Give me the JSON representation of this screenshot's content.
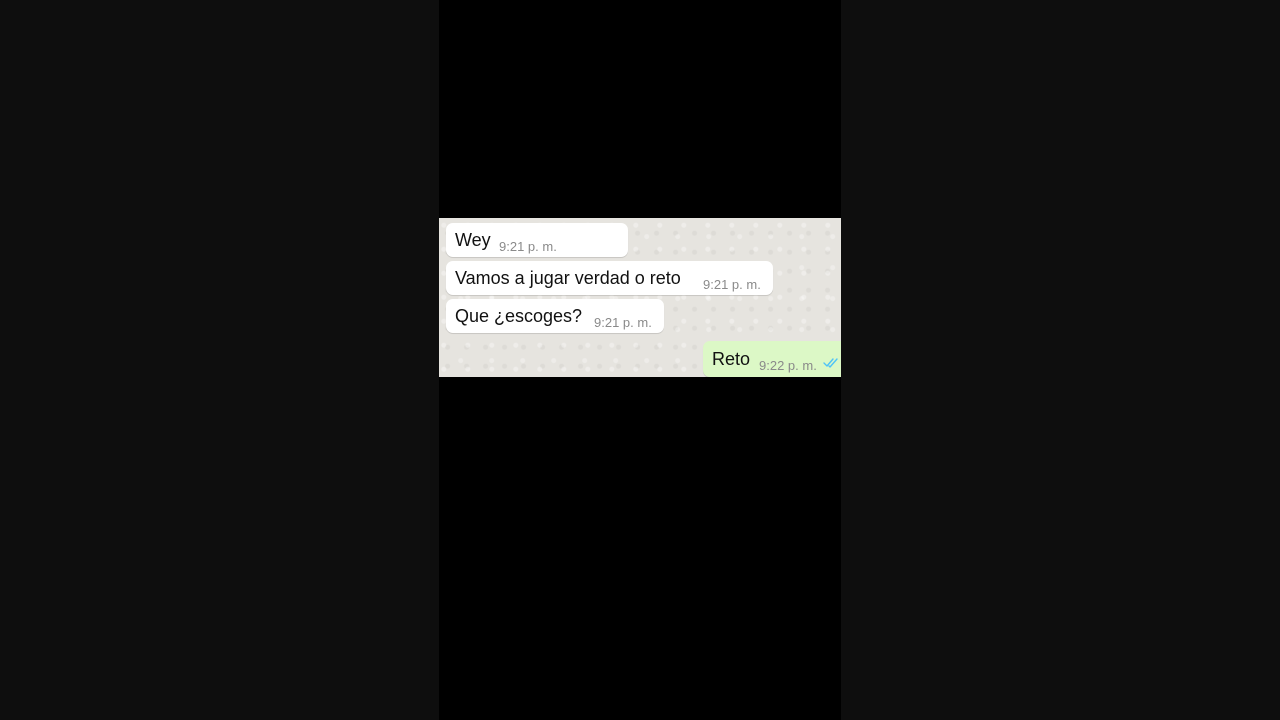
{
  "messages": [
    {
      "direction": "incoming",
      "text": "Wey",
      "time": "9:21 p. m."
    },
    {
      "direction": "incoming",
      "text": "Vamos a jugar verdad o reto",
      "time": "9:21 p. m."
    },
    {
      "direction": "incoming",
      "text": "Que ¿escoges?",
      "time": "9:21 p. m."
    },
    {
      "direction": "outgoing",
      "text": "Reto",
      "time": "9:22 p. m.",
      "status_icon": "double-check-read-icon"
    }
  ],
  "colors": {
    "page_background": "#0e0e0e",
    "phone_background": "#000000",
    "chat_wallpaper": "#e6e4df",
    "incoming_bubble": "#ffffff",
    "outgoing_bubble": "#dcf8c6",
    "read_tick": "#4fc3f7"
  }
}
